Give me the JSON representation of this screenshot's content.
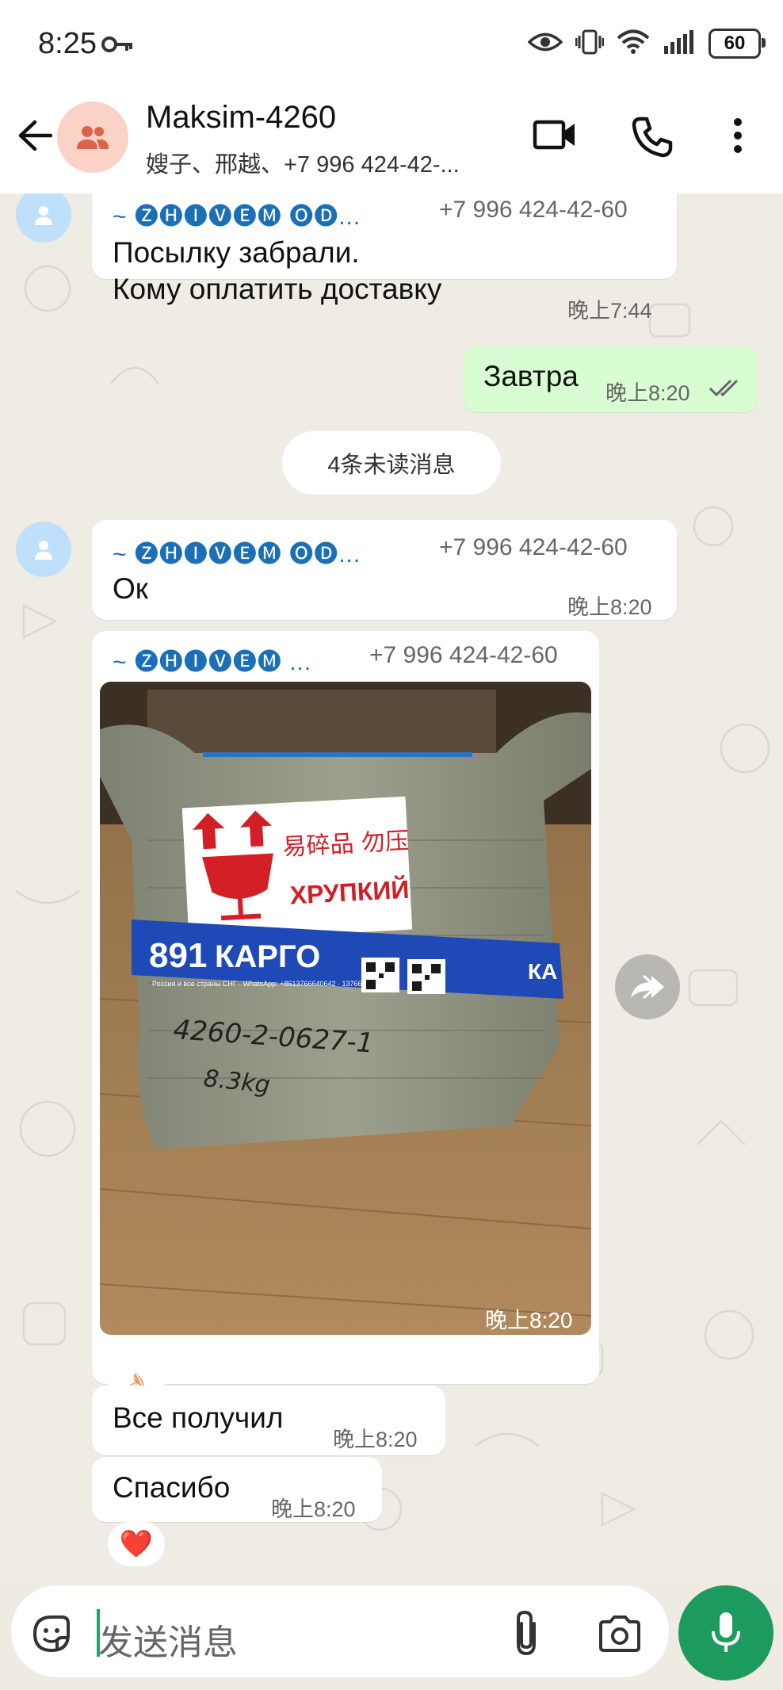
{
  "status_bar": {
    "time": "8:25",
    "battery": "60",
    "icons": [
      "key-icon",
      "eye-icon",
      "vibrate-icon",
      "wifi-icon",
      "signal-icon",
      "battery-icon"
    ]
  },
  "header": {
    "title": "Maksim-4260",
    "subtitle": "嫂子、邢越、+7 996 424-42-...",
    "icons": [
      "back-arrow-icon",
      "group-avatar-icon",
      "video-call-icon",
      "phone-call-icon",
      "more-vert-icon"
    ]
  },
  "messages": {
    "m1": {
      "sender": "~ 🅩🅗🅘🅥🅔🅜 🅞🅓...",
      "phone": "+7 996 424-42-60",
      "line1": "Посылку забрали.",
      "line2": "Кому оплатить доставку",
      "time": "晚上7:44"
    },
    "m2": {
      "text": "Завтра",
      "time": "晚上8:20"
    },
    "unread": "4条未读消息",
    "m3": {
      "sender": "~ 🅩🅗🅘🅥🅔🅜 🅞🅓...",
      "phone": "+7 996 424-42-60",
      "text": "Ок",
      "time": "晚上8:20"
    },
    "m4": {
      "sender": "~ 🅩🅗🅘🅥🅔🅜 ...",
      "phone": "+7 996 424-42-60",
      "time": "晚上8:20",
      "label_cn": "易碎品 勿压",
      "label_ru": "ХРУПКИЙ",
      "tape_num": "891",
      "tape_word": "КАРГО",
      "tape_small": "Россия и все страны СНГ · WhatsApp: +8613766640642 · 13766640642",
      "tape_side": "КА",
      "hw_code": "4260-2-0627-1",
      "hw_weight": "8.3kg",
      "reaction": "👌🏻"
    },
    "m5": {
      "text": "Все получил",
      "time": "晚上8:20"
    },
    "m6": {
      "text": "Спасибо",
      "time": "晚上8:20",
      "reaction": "❤️"
    }
  },
  "input": {
    "placeholder": "发送消息",
    "icons": [
      "sticker-icon",
      "attach-icon",
      "camera-icon",
      "mic-icon"
    ]
  }
}
